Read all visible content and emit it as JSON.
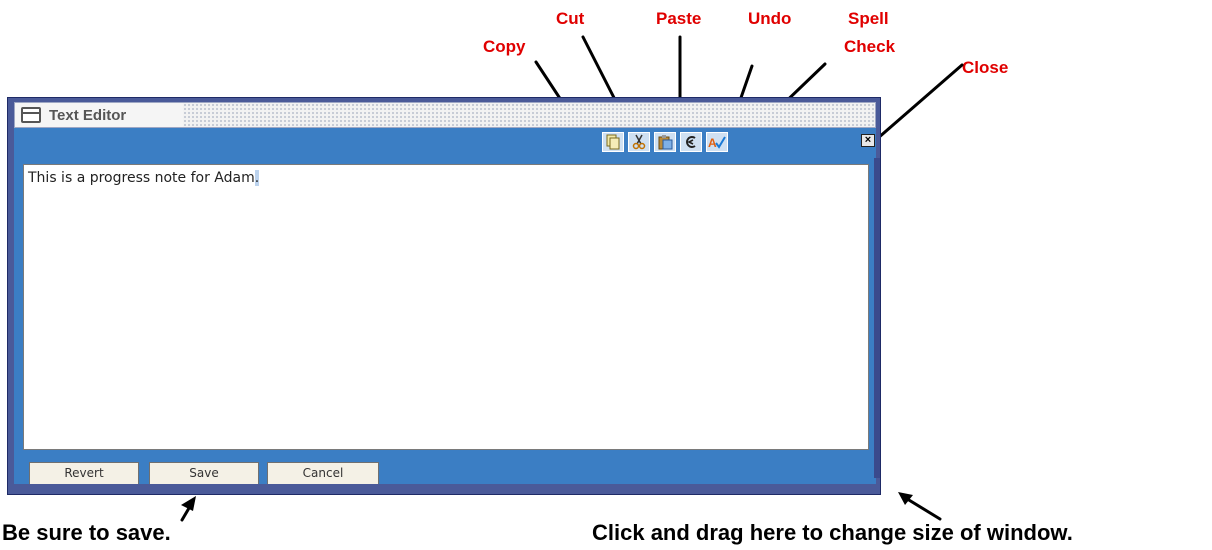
{
  "annotations": {
    "copy": "Copy",
    "cut": "Cut",
    "paste": "Paste",
    "undo": "Undo",
    "spell_check_line1": "Spell",
    "spell_check_line2": "Check",
    "close": "Close"
  },
  "captions": {
    "save_note": "Be sure to save.",
    "resize_note": "Click and drag here to change size of window."
  },
  "window": {
    "title": "Text Editor",
    "editor_text": "This is a progress note for Adam",
    "editor_cursor_char": ".",
    "close_glyph": "×"
  },
  "toolbar_icons": [
    "copy-icon",
    "cut-icon",
    "paste-icon",
    "undo-icon",
    "spell-check-icon"
  ],
  "buttons": {
    "revert": "Revert",
    "save": "Save",
    "cancel": "Cancel"
  },
  "colors": {
    "callout": "#e00000",
    "window_frame": "#4a5a99",
    "toolbar": "#3b7ec4"
  }
}
